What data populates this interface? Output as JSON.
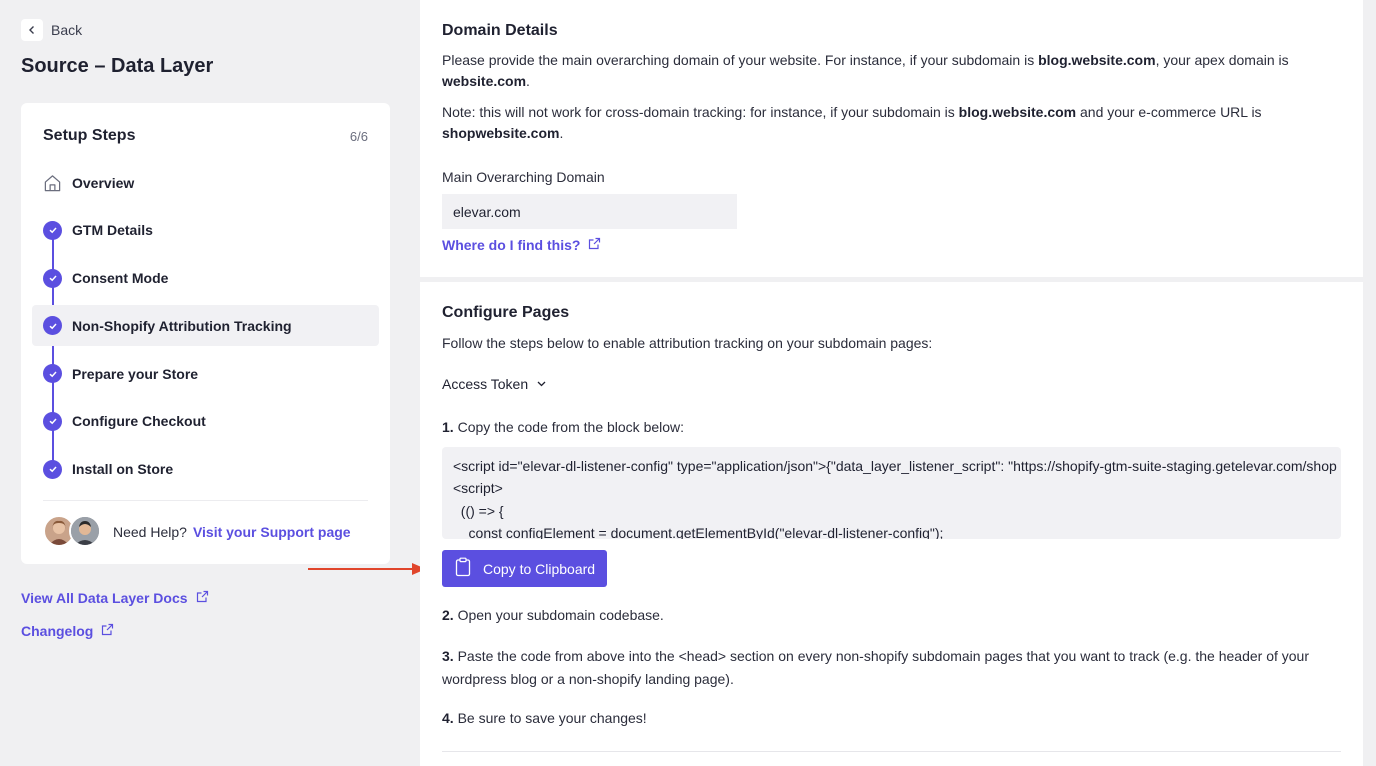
{
  "nav": {
    "back_label": "Back"
  },
  "page": {
    "title": "Source – Data Layer"
  },
  "setup": {
    "title": "Setup Steps",
    "count": "6/6",
    "steps": [
      {
        "label": "Overview",
        "icon": "home-icon",
        "status": "overview"
      },
      {
        "label": "GTM Details",
        "icon": "check-icon",
        "status": "complete"
      },
      {
        "label": "Consent Mode",
        "icon": "check-icon",
        "status": "complete"
      },
      {
        "label": "Non-Shopify Attribution Tracking",
        "icon": "check-icon",
        "status": "complete",
        "active": true
      },
      {
        "label": "Prepare your Store",
        "icon": "check-icon",
        "status": "complete"
      },
      {
        "label": "Configure Checkout",
        "icon": "check-icon",
        "status": "complete"
      },
      {
        "label": "Install on Store",
        "icon": "check-icon",
        "status": "complete"
      }
    ],
    "help": {
      "need_help": "Need Help?",
      "support_link": "Visit your Support page"
    }
  },
  "links": {
    "docs": "View All Data Layer Docs",
    "changelog": "Changelog"
  },
  "domain": {
    "title": "Domain Details",
    "p1_a": "Please provide the main overarching domain of your website. For instance, if your subdomain is ",
    "p1_b": "blog.website.com",
    "p1_c": ", your apex domain is ",
    "p1_d": "website.com",
    "p1_e": ".",
    "p2_a": "Note: this will not work for cross-domain tracking: for instance, if your subdomain is ",
    "p2_b": "blog.website.com",
    "p2_c": " and your e-commerce URL is ",
    "p2_d": "shopwebsite.com",
    "p2_e": ".",
    "field_label": "Main Overarching Domain",
    "field_value": "elevar.com",
    "find_link": "Where do I find this?"
  },
  "pages": {
    "title": "Configure Pages",
    "intro": "Follow the steps below to enable attribution tracking on your subdomain pages:",
    "dropdown_label": "Access Token",
    "step1_num": "1.",
    "step1_text": " Copy the code from the block below:",
    "code_lines": [
      "<script id=\"elevar-dl-listener-config\" type=\"application/json\">{\"data_layer_listener_script\": \"https://shopify-gtm-suite-staging.getelevar.com/shop",
      "<script>",
      "  (() => {",
      "    const configElement = document.getElementById(\"elevar-dl-listener-config\");"
    ],
    "copy_button": "Copy to Clipboard",
    "step2_num": "2.",
    "step2_text": " Open your subdomain codebase.",
    "step3_num": "3.",
    "step3_text": " Paste the code from above into the <head> section on every non-shopify subdomain pages that you want to track (e.g. the header of your wordpress blog or a non-shopify landing page).",
    "step4_num": "4.",
    "step4_text": " Be sure to save your changes!"
  },
  "colors": {
    "accent": "#5b4fe0",
    "arrow": "#e0452b",
    "bg": "#f0f0f2"
  }
}
